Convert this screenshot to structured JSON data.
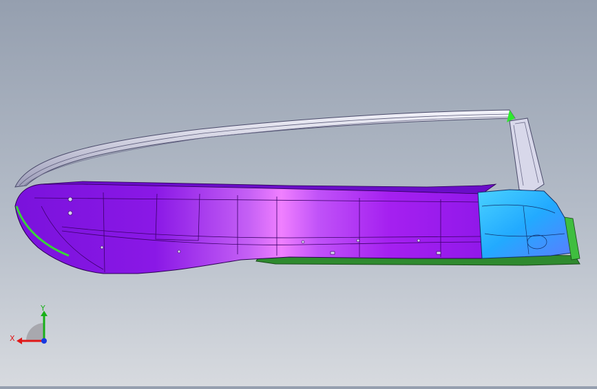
{
  "viewport": {
    "model": "door-panel-assembly",
    "colors": {
      "background_top": "#959faf",
      "background_bottom": "#d7dadf",
      "main_panel": "#8a18e6",
      "panel_highlight": "#f080ff",
      "blue_section": "#22aaff",
      "green_edge": "#2f8a2f",
      "frame": "#d7d7e8"
    }
  },
  "triad": {
    "x_label": "X",
    "y_label": "Y",
    "x_color": "#e01818",
    "y_color": "#18b018",
    "z_color": "#1838e0"
  }
}
